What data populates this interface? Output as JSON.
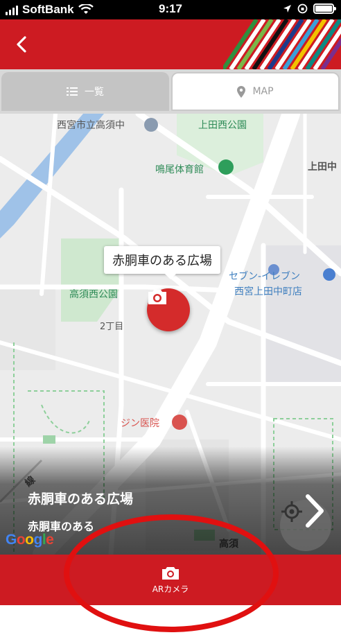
{
  "status_bar": {
    "carrier": "SoftBank",
    "time": "9:17"
  },
  "header": {
    "back_icon": "chevron-left-icon",
    "colors": {
      "header_bg": "#cd1b22"
    }
  },
  "tabs": [
    {
      "label": "一覧",
      "icon": "list-icon",
      "active": false
    },
    {
      "label": "MAP",
      "icon": "map-pin-icon",
      "active": true
    }
  ],
  "map": {
    "labels": {
      "school": "西宮市立高須中",
      "park_top": "上田西公園",
      "gym": "鳴尾体育館",
      "area_right": "上田中",
      "park_left": "高須西公園",
      "block": "2丁目",
      "store_line1": "セブン-イレブン",
      "store_line2": "西宮上田中町店",
      "clinic": "ジン医院",
      "rail": "線",
      "area_bottom": "高須"
    },
    "callout_title": "赤胴車のある広場",
    "google_logo": "Google"
  },
  "place_card": {
    "title": "赤胴車のある広場",
    "subtitle": "赤胴車のある"
  },
  "bottom_bar": {
    "ar_label": "ARカメラ",
    "ar_icon": "camera-icon"
  },
  "colors": {
    "brand_red": "#cd1b22",
    "marker_red": "#d42b2b",
    "annotation_ring": "#e01010"
  }
}
